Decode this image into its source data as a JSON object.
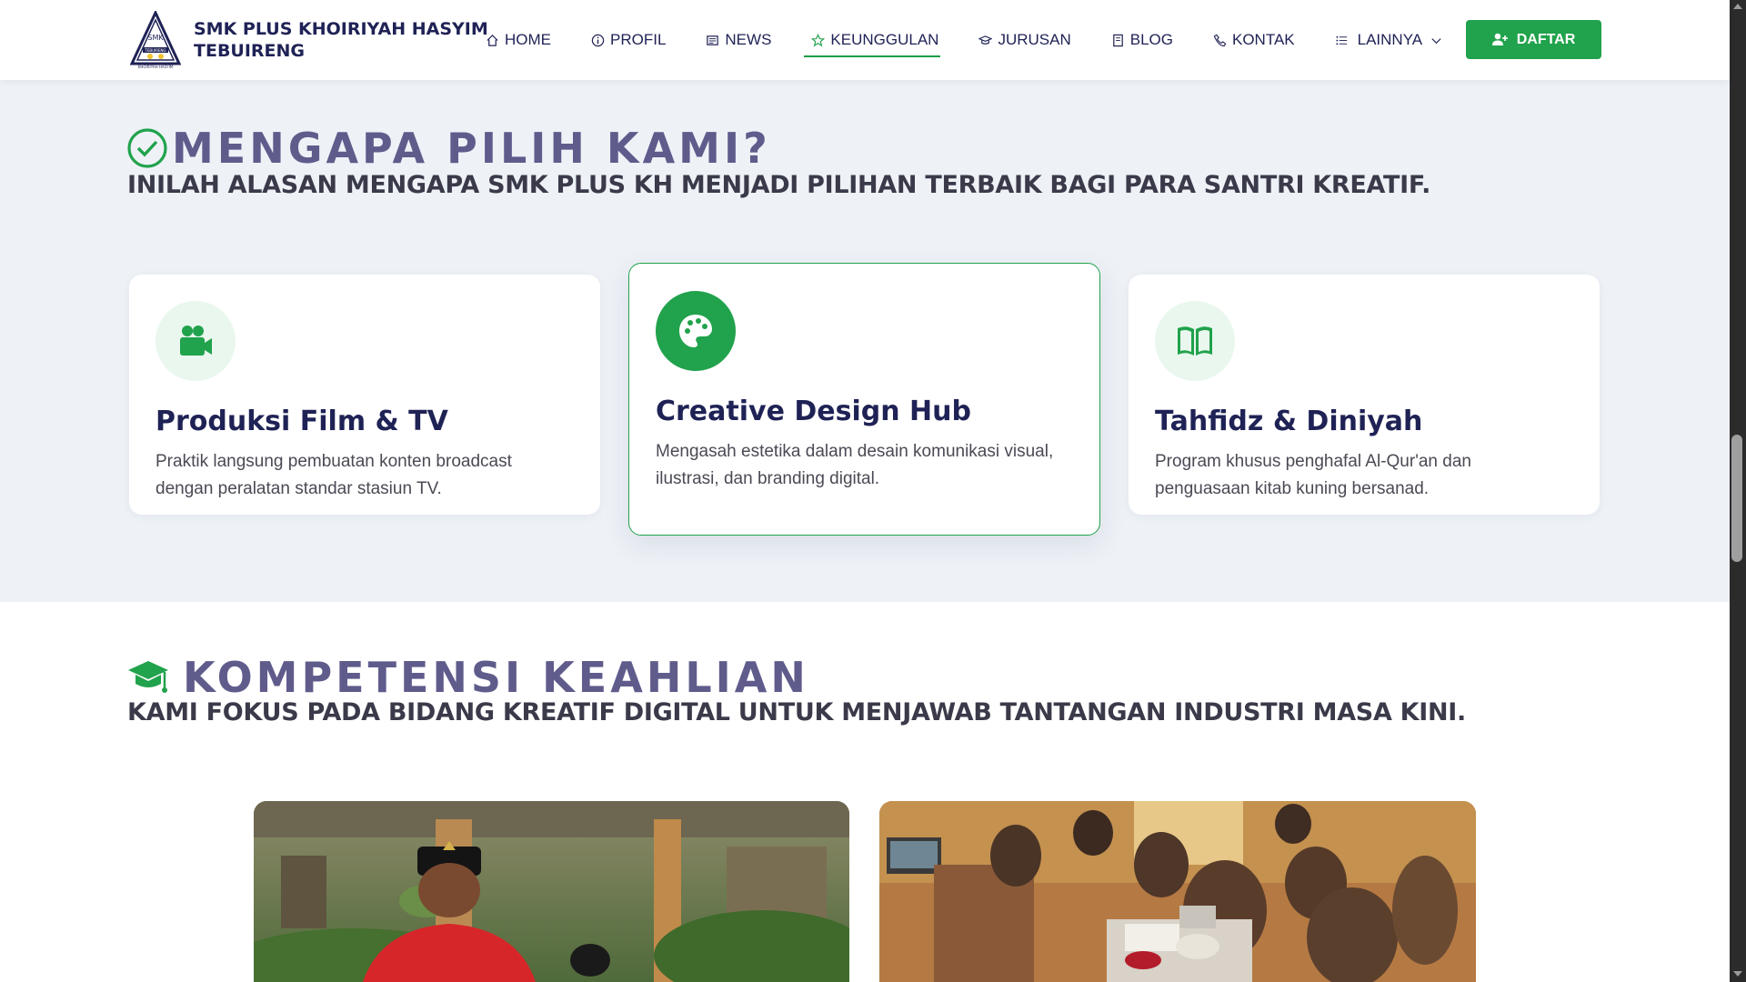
{
  "header": {
    "brand_line1": "SMK PLUS KHOIRIYAH HASYIM",
    "brand_line2": "TEBUIRENG",
    "logo_text_top": "SMK",
    "logo_text_band": "TEBUIRENG",
    "logo_text_bottom": "KHOIRIYAH HASYIM",
    "nav": [
      {
        "label": "HOME",
        "icon": "home-icon"
      },
      {
        "label": "PROFIL",
        "icon": "info-icon"
      },
      {
        "label": "NEWS",
        "icon": "newspaper-icon"
      },
      {
        "label": "KEUNGGULAN",
        "icon": "star-icon",
        "active": true
      },
      {
        "label": "JURUSAN",
        "icon": "graduation-cap-icon"
      },
      {
        "label": "BLOG",
        "icon": "journal-icon"
      },
      {
        "label": "KONTAK",
        "icon": "phone-icon"
      },
      {
        "label": "LAINNYA",
        "icon": "list-icon"
      }
    ],
    "cta_label": "DAFTAR"
  },
  "why": {
    "title": "MENGAPA PILIH KAMI?",
    "subtitle": "INILAH ALASAN MENGAPA SMK PLUS KH MENJADI PILIHAN TERBAIK BAGI PARA SANTRI KREATIF.",
    "cards": [
      {
        "title": "Produksi Film & TV",
        "desc": "Praktik langsung pembuatan konten broadcast dengan peralatan standar stasiun TV.",
        "icon": "video-camera-icon"
      },
      {
        "title": "Creative Design Hub",
        "desc": "Mengasah estetika dalam desain komunikasi visual, ilustrasi, dan branding digital.",
        "icon": "palette-icon"
      },
      {
        "title": "Tahfidz & Diniyah",
        "desc": "Program khusus penghafal Al-Qur'an dan penguasaan kitab kuning bersanad.",
        "icon": "open-book-icon"
      }
    ]
  },
  "competence": {
    "title": "KOMPETENSI KEAHLIAN",
    "subtitle": "KAMI FOKUS PADA BIDANG KREATIF DIGITAL UNTUK MENJAWAB TANTANGAN INDUSTRI MASA KINI."
  },
  "colors": {
    "accent": "#21a24c",
    "navy": "#1f2255",
    "title": "#5f5c8c",
    "section_bg": "#eef2f7"
  }
}
